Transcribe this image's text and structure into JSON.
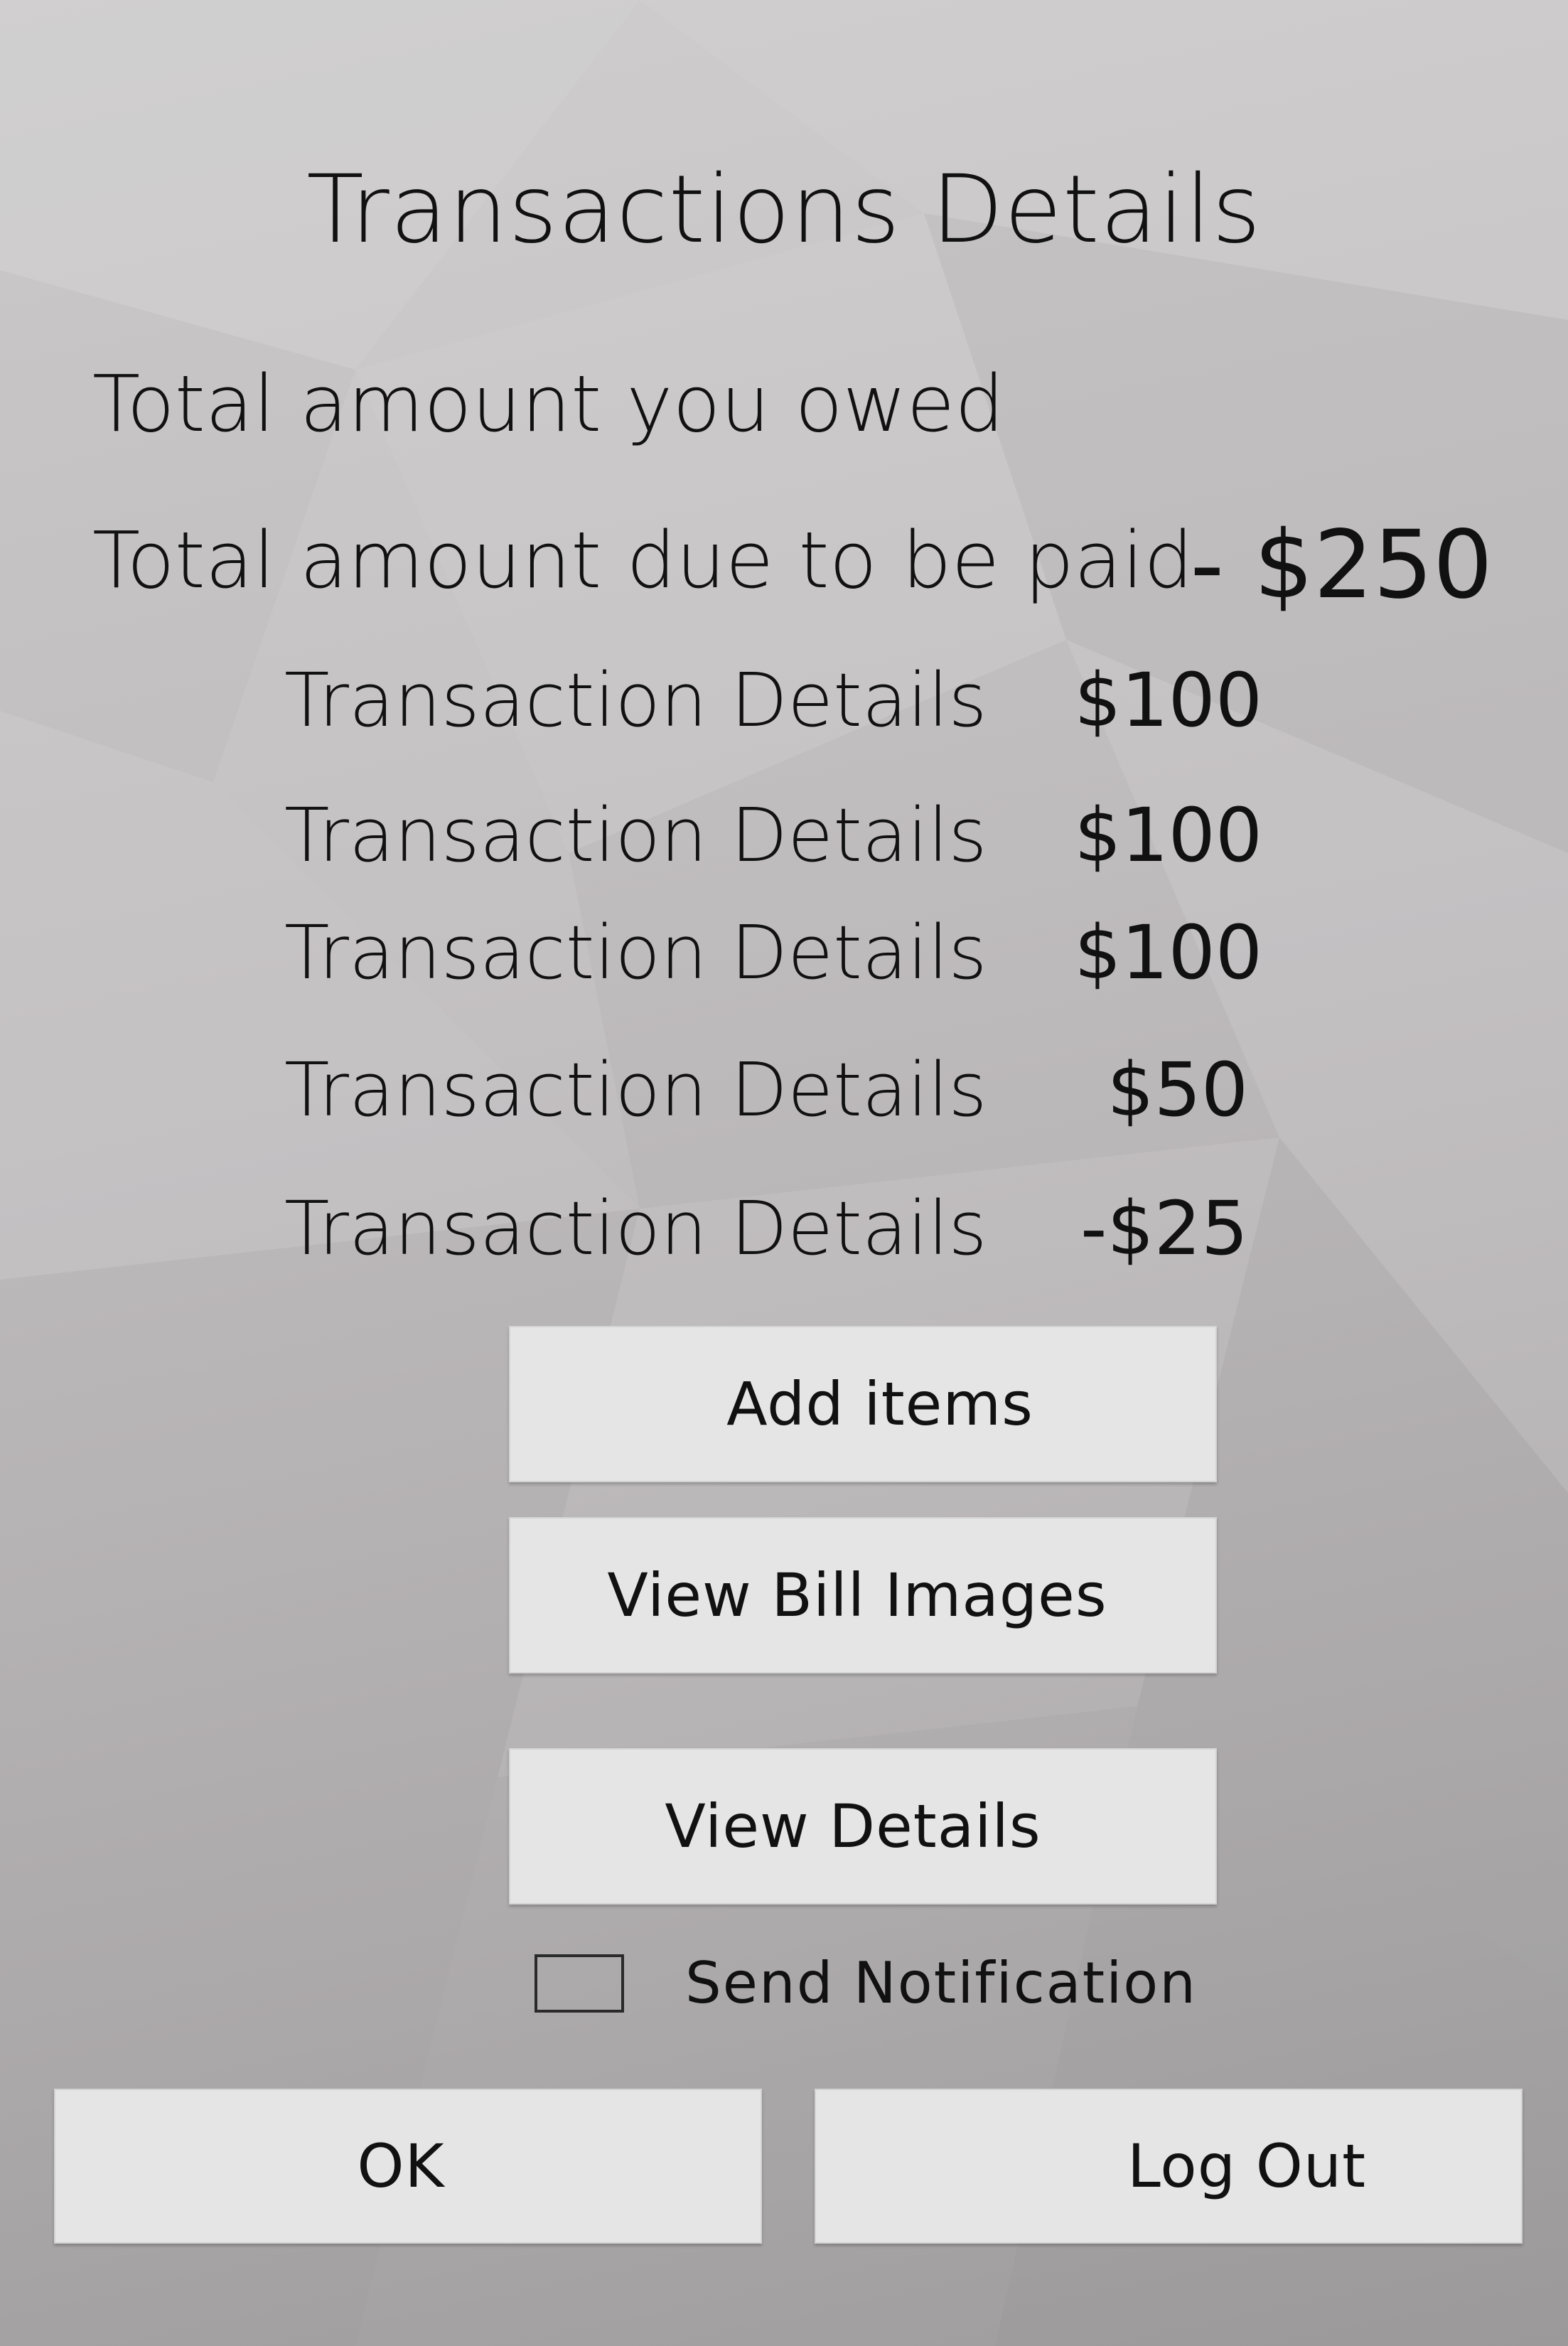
{
  "page": {
    "title": "Transactions Details"
  },
  "summary": {
    "owed_label": "Total amount you owed",
    "due_label": "Total amount due to be paid",
    "due_value": "- $250"
  },
  "transactions": [
    {
      "label": "Transaction Details",
      "amount": "$100"
    },
    {
      "label": "Transaction Details",
      "amount": "$100"
    },
    {
      "label": "Transaction Details",
      "amount": "$100"
    },
    {
      "label": "Transaction Details",
      "amount": "$50"
    },
    {
      "label": "Transaction Details",
      "amount": "-$25"
    }
  ],
  "actions": {
    "add_items": "Add items",
    "view_bill_images": "View Bill Images",
    "view_details": "View Details"
  },
  "notification": {
    "label": "Send Notification",
    "checked": false
  },
  "footer": {
    "ok": "OK",
    "logout": "Log Out"
  },
  "colors": {
    "button_bg": "#e6e5e6",
    "text": "#111111",
    "background_top": "#cfcdcd",
    "background_bottom": "#a2a0a0"
  }
}
